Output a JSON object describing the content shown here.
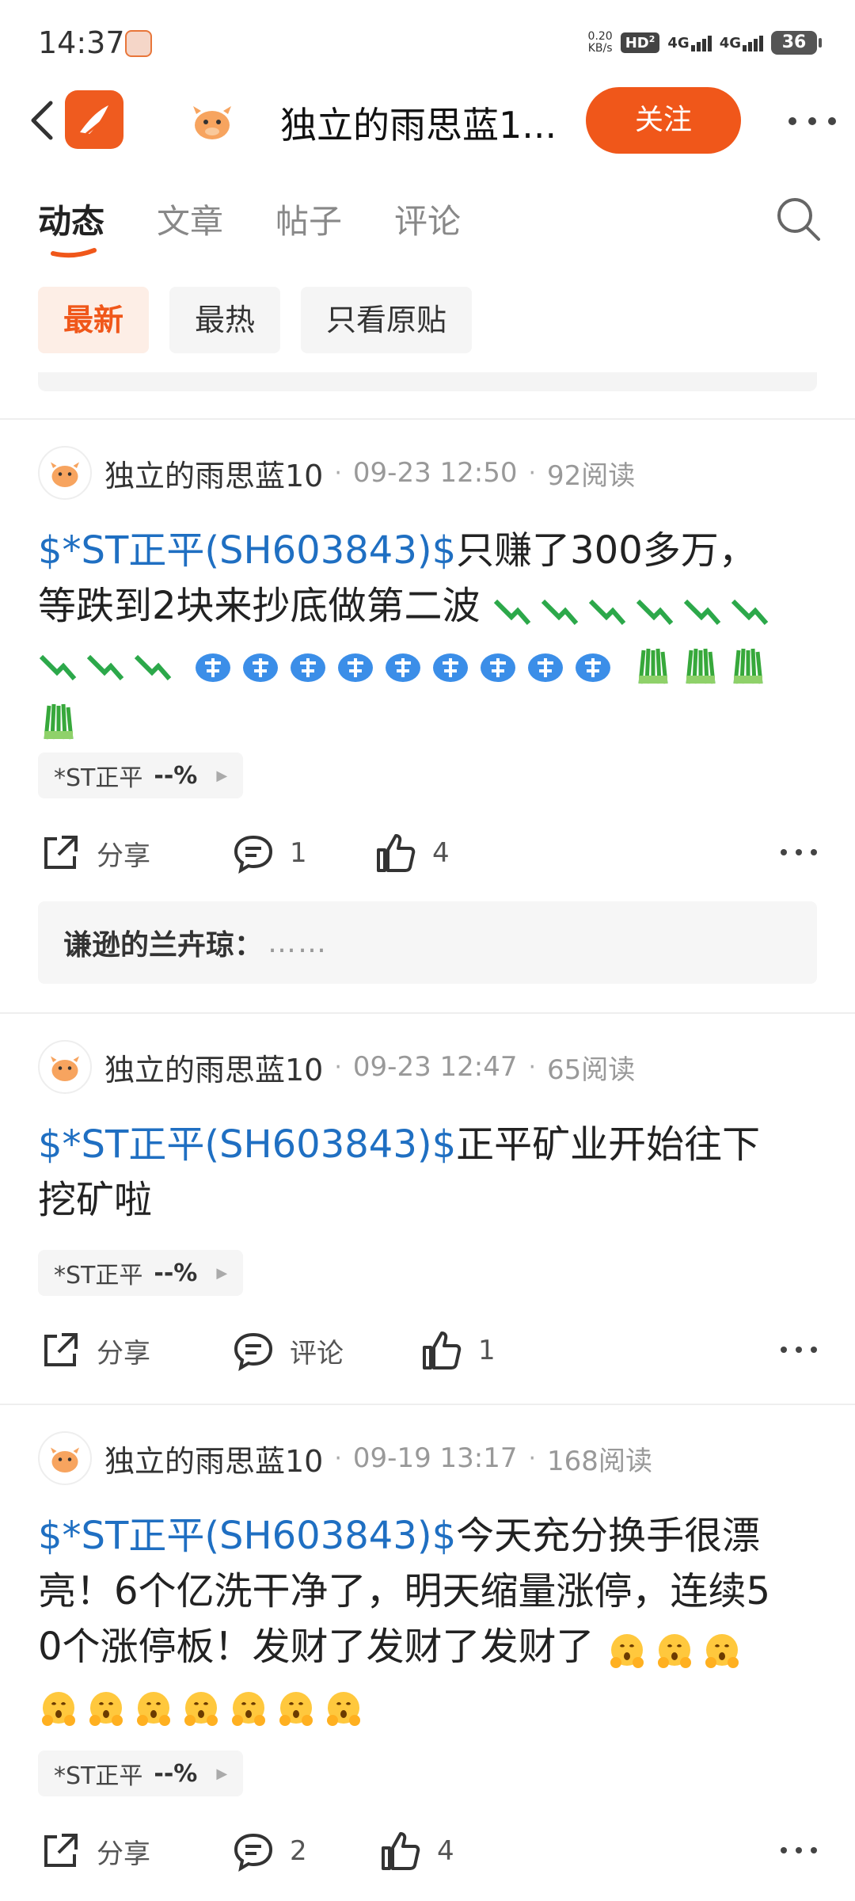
{
  "status_bar": {
    "time": "14:37",
    "net_speed_value": "0.20",
    "net_speed_unit": "KB/s",
    "hd": "HD",
    "sim": "2",
    "signal1": "4G",
    "signal2": "4G",
    "battery": "36"
  },
  "header": {
    "title": "独立的雨思蓝1...",
    "follow_label": "关注"
  },
  "tabs": [
    {
      "label": "动态",
      "active": true
    },
    {
      "label": "文章",
      "active": false
    },
    {
      "label": "帖子",
      "active": false
    },
    {
      "label": "评论",
      "active": false
    }
  ],
  "filters": [
    {
      "label": "最新",
      "active": true
    },
    {
      "label": "最热",
      "active": false
    },
    {
      "label": "只看原贴",
      "active": false
    }
  ],
  "posts": [
    {
      "author": "独立的雨思蓝10",
      "time": "09-23 12:50",
      "reads": "92阅读",
      "ticker": "$*ST正平(SH603843)$",
      "text_line1": "只赚了300多万，",
      "text_line2": "等跌到2块来抄底做第二波",
      "stock_name": "*ST正平",
      "stock_change": "--%",
      "share_label": "分享",
      "comment_count": "1",
      "like_count": "4",
      "reply_author": "谦逊的兰卉琼：",
      "reply_text": "……"
    },
    {
      "author": "独立的雨思蓝10",
      "time": "09-23 12:47",
      "reads": "65阅读",
      "ticker": "$*ST正平(SH603843)$",
      "text_line1": "正平矿业开始往下",
      "text_line2": "挖矿啦",
      "stock_name": "*ST正平",
      "stock_change": "--%",
      "share_label": "分享",
      "comment_label": "评论",
      "like_count": "1"
    },
    {
      "author": "独立的雨思蓝10",
      "time": "09-19 13:17",
      "reads": "168阅读",
      "ticker": "$*ST正平(SH603843)$",
      "text_line1": "今天充分换手很漂",
      "text_line2": "亮！6个亿洗干净了，明天缩量涨停，连续5",
      "text_line3": "0个涨停板！发财了发财了发财了",
      "stock_name": "*ST正平",
      "stock_change": "--%",
      "share_label": "分享",
      "comment_count": "2",
      "like_count": "4"
    }
  ],
  "colors": {
    "brand": "#f0571a",
    "ticker_link": "#1f6fc2"
  }
}
